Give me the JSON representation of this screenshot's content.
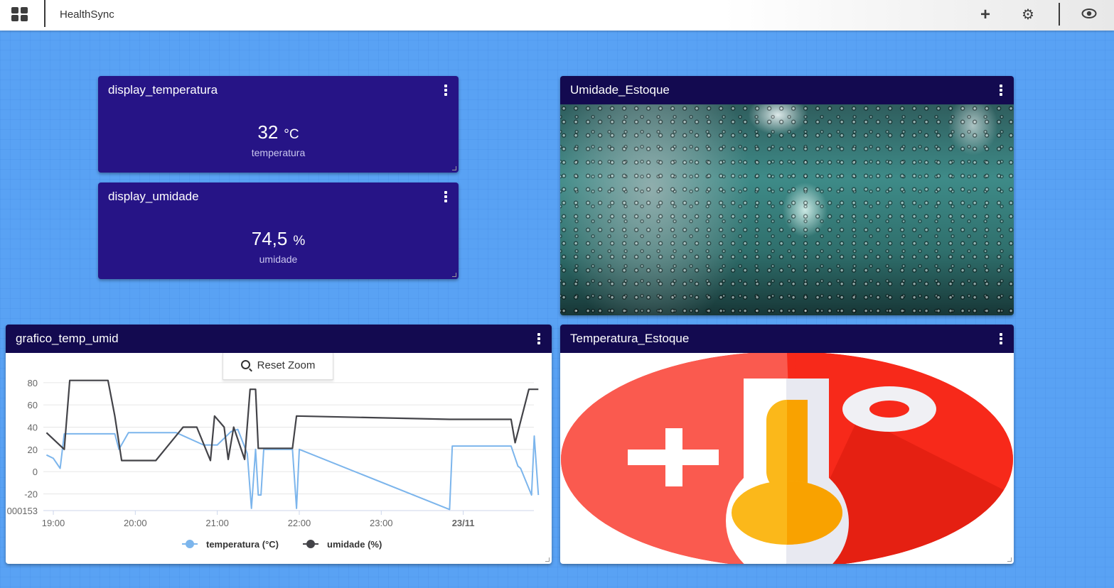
{
  "app": {
    "title": "HealthSync"
  },
  "toolbar": {
    "menu_icon": "dashboard-grid-icon",
    "add_icon": "plus-icon",
    "settings_icon": "gear-icon",
    "view_icon": "eye-icon"
  },
  "widgets": {
    "display_temperatura": {
      "title": "display_temperatura",
      "value": "32",
      "unit": "°C",
      "label": "temperatura"
    },
    "display_umidade": {
      "title": "display_umidade",
      "value": "74,5",
      "unit": "%",
      "label": "umidade"
    },
    "umidade_estoque": {
      "title": "Umidade_Estoque"
    },
    "temperatura_estoque": {
      "title": "Temperatura_Estoque"
    },
    "grafico": {
      "title": "grafico_temp_umid",
      "reset_zoom": "Reset Zoom"
    }
  },
  "chart_data": {
    "type": "line",
    "y_ticks": [
      "80",
      "60",
      "40",
      "20",
      "0",
      "-20",
      "000153"
    ],
    "x_ticks": [
      "19:00",
      "20:00",
      "21:00",
      "22:00",
      "23:00",
      "23/11"
    ],
    "ylim": [
      -35,
      85
    ],
    "xlim": [
      "19:00",
      "00:59"
    ],
    "legend_position": "bottom",
    "series": [
      {
        "name": "temperatura (°C)",
        "color": "#7cb5ec",
        "points": [
          [
            "18:55",
            15
          ],
          [
            "19:00",
            12
          ],
          [
            "19:05",
            3
          ],
          [
            "19:08",
            34
          ],
          [
            "19:20",
            34
          ],
          [
            "19:45",
            34
          ],
          [
            "19:48",
            20
          ],
          [
            "19:55",
            35
          ],
          [
            "20:15",
            35
          ],
          [
            "20:30",
            35
          ],
          [
            "20:50",
            24
          ],
          [
            "21:00",
            24
          ],
          [
            "21:10",
            36
          ],
          [
            "21:15",
            38
          ],
          [
            "21:22",
            16
          ],
          [
            "21:25",
            -33
          ],
          [
            "21:28",
            20
          ],
          [
            "21:30",
            -21
          ],
          [
            "21:32",
            -21
          ],
          [
            "21:34",
            20
          ],
          [
            "21:55",
            20
          ],
          [
            "21:58",
            -33
          ],
          [
            "22:00",
            20
          ],
          [
            "23:50",
            -34
          ],
          [
            "23:52",
            23
          ],
          [
            "00:35",
            23
          ],
          [
            "00:40",
            5
          ],
          [
            "00:42",
            3
          ],
          [
            "00:50",
            -21
          ],
          [
            "00:52",
            32
          ],
          [
            "00:55",
            -21
          ]
        ]
      },
      {
        "name": "umidade (%)",
        "color": "#434348",
        "points": [
          [
            "18:55",
            35
          ],
          [
            "19:08",
            20
          ],
          [
            "19:12",
            82
          ],
          [
            "19:40",
            82
          ],
          [
            "19:45",
            50
          ],
          [
            "19:50",
            10
          ],
          [
            "20:15",
            10
          ],
          [
            "20:35",
            40
          ],
          [
            "20:45",
            40
          ],
          [
            "20:55",
            10
          ],
          [
            "20:58",
            50
          ],
          [
            "21:05",
            40
          ],
          [
            "21:08",
            11
          ],
          [
            "21:12",
            40
          ],
          [
            "21:20",
            11
          ],
          [
            "21:24",
            74
          ],
          [
            "21:28",
            74
          ],
          [
            "21:30",
            21
          ],
          [
            "21:35",
            21
          ],
          [
            "21:55",
            21
          ],
          [
            "21:58",
            50
          ],
          [
            "23:50",
            47
          ],
          [
            "00:35",
            47
          ],
          [
            "00:38",
            26
          ],
          [
            "00:48",
            74
          ],
          [
            "00:55",
            74
          ]
        ]
      }
    ]
  }
}
